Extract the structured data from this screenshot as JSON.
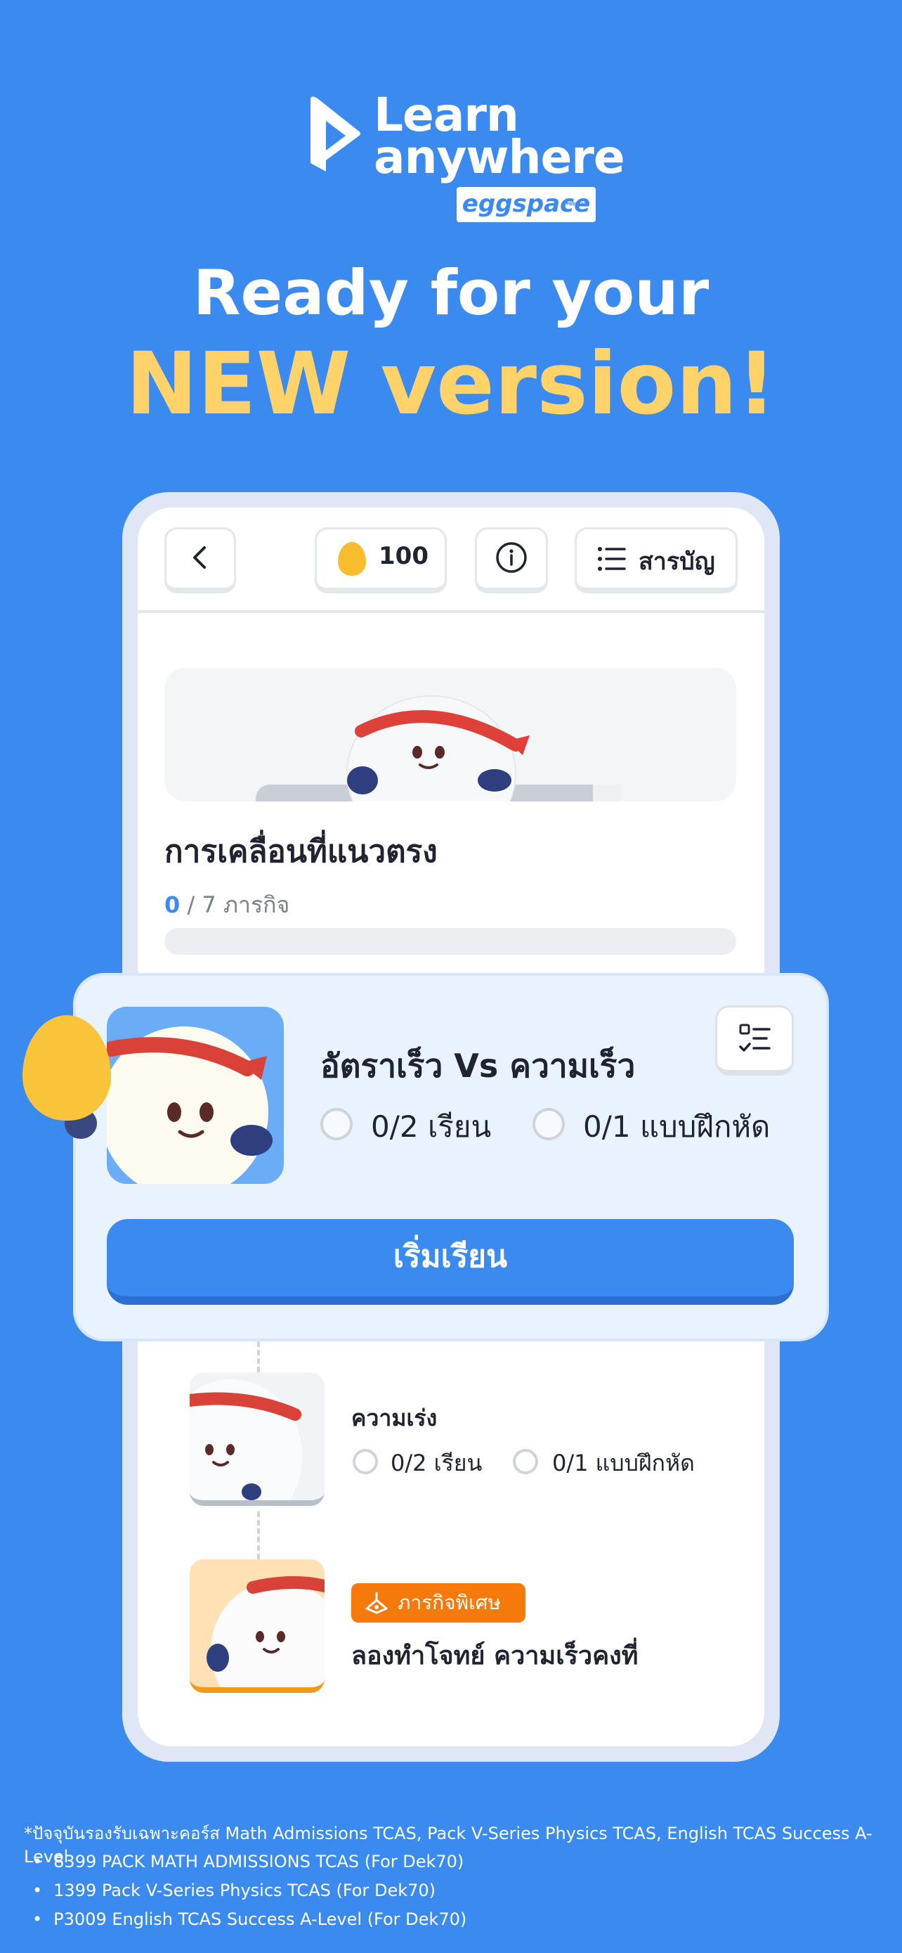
{
  "brand": {
    "line1": "Learn",
    "line2": "anywhere",
    "badge": "eggspace",
    "badge_small": "eggspace"
  },
  "headline": {
    "line1": "Ready for your",
    "line2": "NEW version!"
  },
  "app": {
    "coins": "100",
    "toc_label": "สารบัญ",
    "chapter_title": "การเคลื่อนที่แนวตรง",
    "chapter_progress_done": "0",
    "chapter_progress_rest": " / 7 ภารกิจ",
    "chapter_progress_fraction": 0
  },
  "card": {
    "title": "อัตราเร็ว Vs ความเร็ว",
    "task_learn": "0/2 เรียน",
    "task_practice": "0/1 แบบฝึกหัด",
    "start_button": "เริ่มเรียน"
  },
  "lessons": [
    {
      "title": "ความเร่ง",
      "task_learn": "0/2 เรียน",
      "task_practice": "0/1 แบบฝึกหัด"
    },
    {
      "badge": "ภารกิจพิเศษ",
      "title": "ลองทำโจทย์ ความเร็วคงที่"
    }
  ],
  "footer": {
    "note": "*ปัจจุบันรองรับเฉพาะคอร์ส Math Admissions TCAS, Pack V-Series Physics TCAS, English TCAS Success A-Level",
    "items": [
      "8399 PACK MATH ADMISSIONS TCAS (For Dek70)",
      "1399 Pack V-Series Physics TCAS (For Dek70)",
      "P3009 English TCAS Success A-Level (For Dek70)"
    ]
  },
  "colors": {
    "background": "#3b8af0",
    "accent_yellow": "#ffd36a",
    "primary_button": "#3b8af0",
    "special_badge": "#f57a0b"
  }
}
